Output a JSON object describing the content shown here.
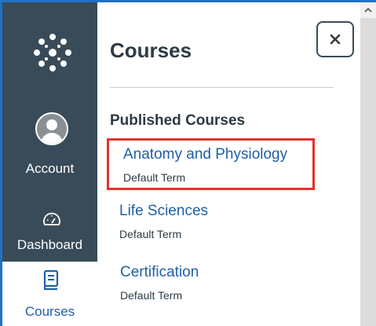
{
  "global_nav": {
    "account_label": "Account",
    "dashboard_label": "Dashboard",
    "courses_label": "Courses"
  },
  "tray": {
    "title": "Courses",
    "section_heading": "Published Courses",
    "courses": [
      {
        "name": "Anatomy and Physiology",
        "term": "Default Term",
        "highlighted": true
      },
      {
        "name": "Life Sciences",
        "term": "Default Term",
        "highlighted": false
      },
      {
        "name": "Certification",
        "term": "Default Term",
        "highlighted": false
      }
    ]
  },
  "colors": {
    "nav_background": "#394b58",
    "link": "#1f5fa6",
    "highlight_border": "#e5322d",
    "frame_border": "#1f72c4"
  },
  "icons": [
    "canvas-logo-icon",
    "avatar-icon",
    "dashboard-gauge-icon",
    "courses-book-icon",
    "close-icon",
    "scroll-up-icon"
  ]
}
